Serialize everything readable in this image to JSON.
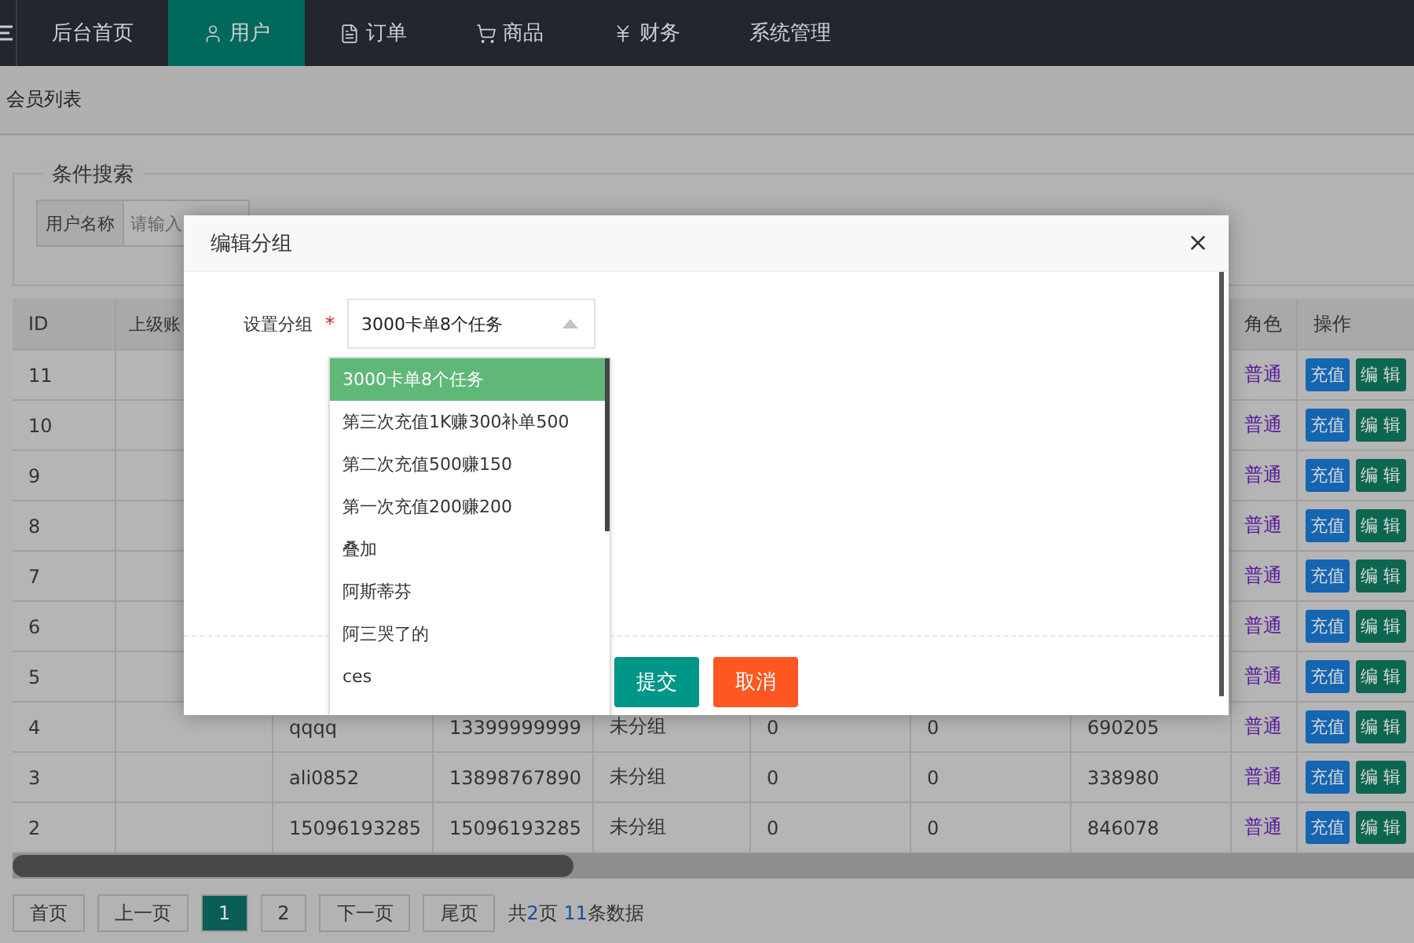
{
  "nav": {
    "items": [
      {
        "label": "后台首页",
        "kind": "plain",
        "selected": false
      },
      {
        "label": "用户",
        "kind": "user",
        "selected": true
      },
      {
        "label": "订单",
        "kind": "file",
        "selected": false
      },
      {
        "label": "商品",
        "kind": "cart",
        "selected": false
      },
      {
        "label": "财务",
        "kind": "yen",
        "selected": false
      },
      {
        "label": "系统管理",
        "kind": "plain",
        "selected": false
      }
    ]
  },
  "breadcrumb": "会员列表",
  "search": {
    "legend": "条件搜索",
    "label": "用户名称",
    "placeholder": "请输入"
  },
  "table": {
    "header": {
      "id": "ID",
      "column_2": "上级账",
      "role": "角色",
      "actions": "操作"
    },
    "rows": [
      {
        "id": "11",
        "role": "普通",
        "actions": [
          "充值",
          "编 辑"
        ]
      },
      {
        "id": "10",
        "role": "普通",
        "actions": [
          "充值",
          "编 辑"
        ]
      },
      {
        "id": "9",
        "role": "普通",
        "actions": [
          "充值",
          "编 辑"
        ]
      },
      {
        "id": "8",
        "role": "普通",
        "actions": [
          "充值",
          "编 辑"
        ]
      },
      {
        "id": "7",
        "role": "普通",
        "actions": [
          "充值",
          "编 辑"
        ]
      },
      {
        "id": "6",
        "role": "普通",
        "actions": [
          "充值",
          "编 辑"
        ]
      },
      {
        "id": "5",
        "role": "普通",
        "actions": [
          "充值",
          "编 辑"
        ]
      },
      {
        "id": "4",
        "username": "qqqq",
        "phone": "13399999999",
        "group": "未分组",
        "column_6": "0",
        "column_7": "0",
        "column_8": "690205",
        "role": "普通",
        "actions": [
          "充值",
          "编 辑"
        ]
      },
      {
        "id": "3",
        "username": "ali0852",
        "phone": "13898767890",
        "group": "未分组",
        "column_6": "0",
        "column_7": "0",
        "column_8": "338980",
        "role": "普通",
        "actions": [
          "充值",
          "编 辑"
        ]
      },
      {
        "id": "2",
        "username": "15096193285",
        "phone": "15096193285",
        "group": "未分组",
        "column_6": "0",
        "column_7": "0",
        "column_8": "846078",
        "role": "普通",
        "actions": [
          "充值",
          "编 辑"
        ]
      }
    ]
  },
  "pagination": {
    "buttons": [
      {
        "label": "首页",
        "selected": false
      },
      {
        "label": "上一页",
        "selected": false
      },
      {
        "label": "1",
        "selected": true
      },
      {
        "label": "2",
        "selected": false
      },
      {
        "label": "下一页",
        "selected": false
      },
      {
        "label": "尾页",
        "selected": false
      }
    ],
    "summary": "共**2**页 **11**条数据"
  },
  "modal": {
    "title": "编辑分组",
    "field_label": "设置分组",
    "required_mark": "*",
    "value": "3000卡单8个任务",
    "expanded": true,
    "options": [
      {
        "label": "3000卡单8个任务",
        "selected": true
      },
      {
        "label": "第三次充值1K赚300补单500",
        "selected": false
      },
      {
        "label": "第二次充值500赚150",
        "selected": false
      },
      {
        "label": "第一次充值200赚200",
        "selected": false
      },
      {
        "label": "叠加",
        "selected": false
      },
      {
        "label": "阿斯蒂芬",
        "selected": false
      },
      {
        "label": "阿三哭了的",
        "selected": false
      },
      {
        "label": "ces",
        "selected": false
      }
    ],
    "buttons": [
      {
        "label": "提交",
        "kind": "primary"
      },
      {
        "label": "取消",
        "kind": "danger"
      }
    ]
  }
}
